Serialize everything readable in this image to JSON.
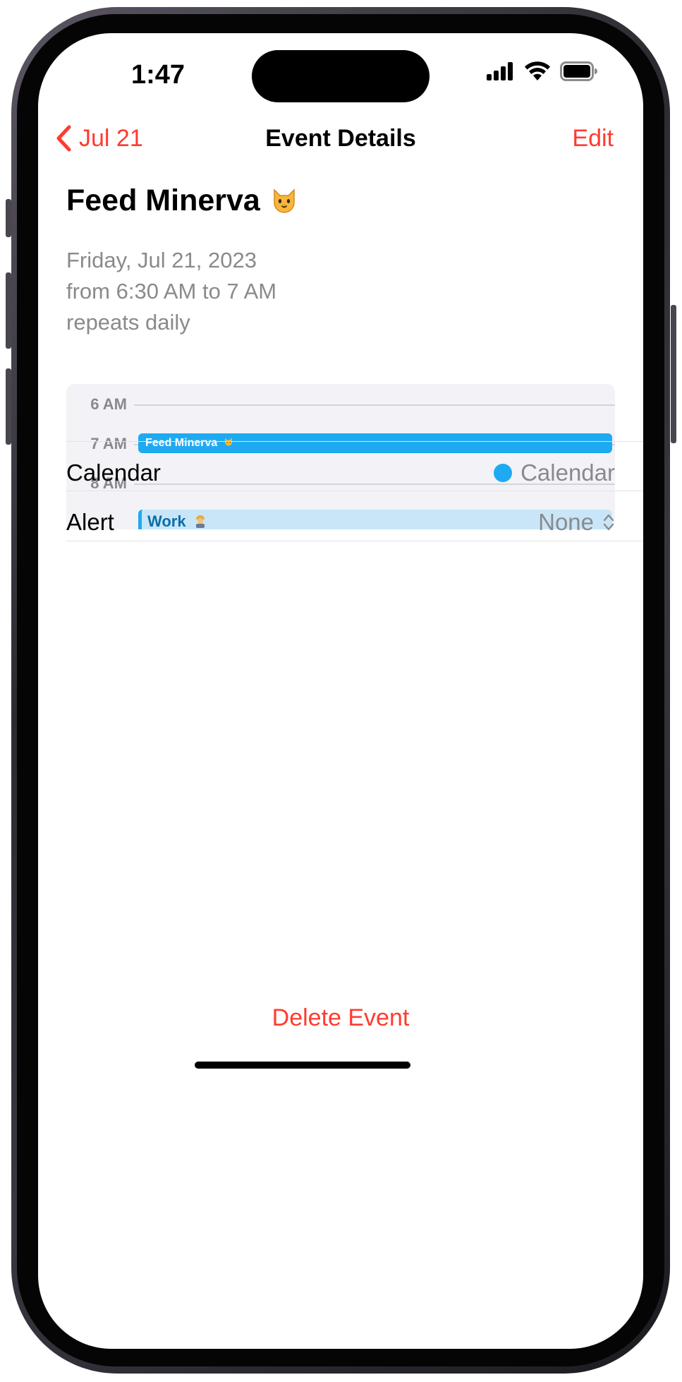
{
  "status_bar": {
    "time": "1:47"
  },
  "nav": {
    "back_label": "Jul 21",
    "title": "Event Details",
    "edit_label": "Edit",
    "accent_color": "#ff3b30"
  },
  "event": {
    "title": "Feed Minerva",
    "title_icon": "cat-face-icon",
    "date_line": "Friday, Jul 21, 2023",
    "time_line": "from 6:30 AM to 7 AM",
    "repeat_line": "repeats daily"
  },
  "timeline": {
    "hours": [
      "6 AM",
      "7 AM",
      "8 AM"
    ],
    "events": [
      {
        "label": "Feed Minerva",
        "icon": "cat-face-icon",
        "color": "#1eaaf1"
      },
      {
        "label": "Work",
        "icon": "worker-icon",
        "color": "#c8e6f8"
      }
    ]
  },
  "rows": {
    "calendar": {
      "label": "Calendar",
      "value": "Calendar",
      "color": "#1eaaf1"
    },
    "alert": {
      "label": "Alert",
      "value": "None"
    }
  },
  "actions": {
    "delete_label": "Delete Event"
  }
}
